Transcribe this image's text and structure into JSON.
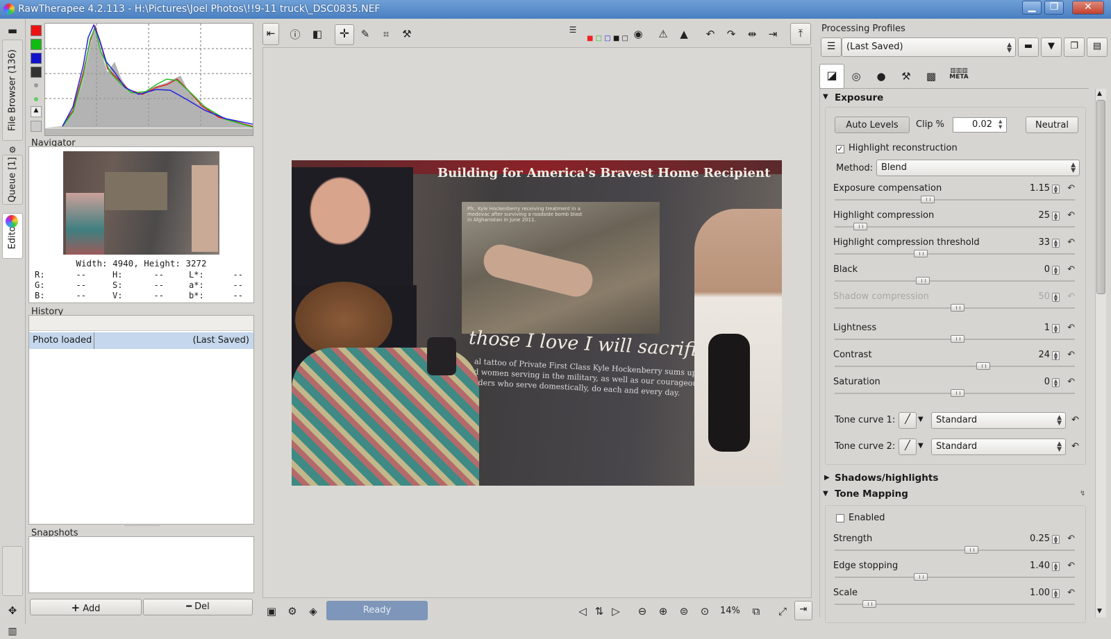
{
  "window": {
    "title": "RawTherapee 4.2.113 - H:\\Pictures\\Joel Photos\\!!9-11 truck\\_DSC0835.NEF",
    "minimize": "▁",
    "maximize": "❐",
    "close": "✕"
  },
  "side_tabs": {
    "file_browser": "File Browser (136)",
    "queue": "Queue [1]",
    "editor": "Editor"
  },
  "navigator": {
    "title": "Navigator",
    "size_text": "Width: 4940, Height: 3272",
    "readout": [
      [
        "R:",
        "--",
        "H:",
        "--",
        "L*:",
        "--"
      ],
      [
        "G:",
        "--",
        "S:",
        "--",
        "a*:",
        "--"
      ],
      [
        "B:",
        "--",
        "V:",
        "--",
        "b*:",
        "--"
      ]
    ]
  },
  "history": {
    "title": "History",
    "rows": [
      {
        "action": "Photo loaded",
        "value": "(Last Saved)"
      }
    ]
  },
  "snapshots": {
    "title": "Snapshots",
    "add_label": "Add",
    "del_label": "Del"
  },
  "statusbar": {
    "status": "Ready",
    "zoom": "14%"
  },
  "photo": {
    "banner": "Building for America's Bravest Home Recipient",
    "quote": "those I love I will sacrifice",
    "caption_lines": [
      "al tattoo of Private First Class Kyle Hockenberry sums up what th",
      "d women serving in the military, as well as our courageous first",
      "nders who serve domestically, do each and every day."
    ],
    "poster_text": "Pfc. Kyle Hockenberry receiving treatment in a medevac after surviving a roadside bomb blast in Afghanistan in June 2011."
  },
  "profiles": {
    "title": "Processing Profiles",
    "selected": "(Last Saved)"
  },
  "tool_tabs": [
    "exposure",
    "detail",
    "color",
    "transform",
    "raw",
    "META"
  ],
  "exposure": {
    "title": "Exposure",
    "auto_levels": "Auto Levels",
    "clip_label": "Clip %",
    "clip_value": "0.02",
    "neutral": "Neutral",
    "highlight_reconstruction": "Highlight reconstruction",
    "method_label": "Method:",
    "method_value": "Blend",
    "sliders": [
      {
        "label": "Exposure compensation",
        "value": "1.15",
        "pos": 0.37
      },
      {
        "label": "Highlight compression",
        "value": "25",
        "pos": 0.08
      },
      {
        "label": "Highlight compression threshold",
        "value": "33",
        "pos": 0.34
      },
      {
        "label": "Black",
        "value": "0",
        "pos": 0.35
      },
      {
        "label": "Shadow compression",
        "value": "50",
        "pos": 0.5,
        "disabled": true
      },
      {
        "label": "Lightness",
        "value": "1",
        "pos": 0.5
      },
      {
        "label": "Contrast",
        "value": "24",
        "pos": 0.61
      },
      {
        "label": "Saturation",
        "value": "0",
        "pos": 0.5
      }
    ],
    "tone_curve1_label": "Tone curve 1:",
    "tone_curve1_value": "Standard",
    "tone_curve2_label": "Tone curve 2:",
    "tone_curve2_value": "Standard"
  },
  "shadows_highlights": {
    "title": "Shadows/highlights"
  },
  "tone_mapping": {
    "title": "Tone Mapping",
    "enabled_label": "Enabled",
    "sliders": [
      {
        "label": "Strength",
        "value": "0.25",
        "pos": 0.56
      },
      {
        "label": "Edge stopping",
        "value": "1.40",
        "pos": 0.34
      },
      {
        "label": "Scale",
        "value": "1.00",
        "pos": 0.12
      }
    ]
  }
}
